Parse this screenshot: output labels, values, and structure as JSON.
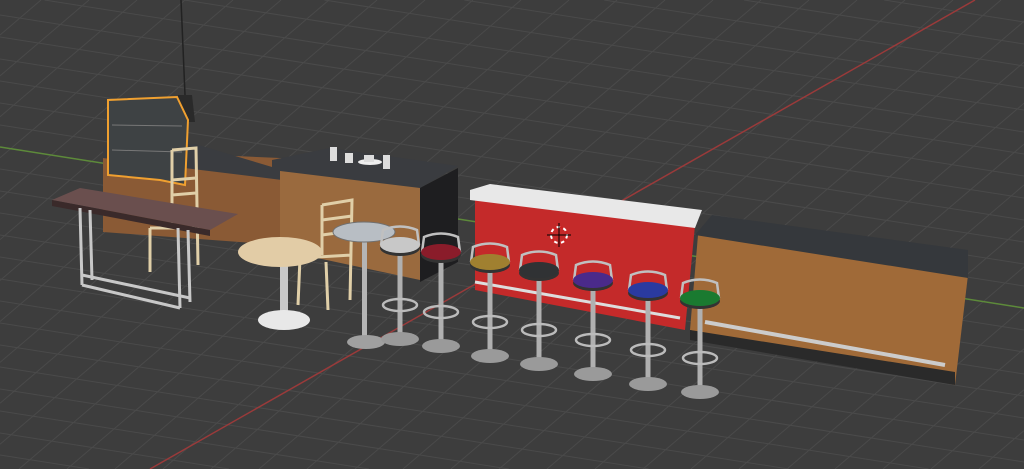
{
  "viewport": {
    "background": "#3d3d3d",
    "grid_color": "#4a4a4a",
    "x_axis_color": "#9a3a3a",
    "y_axis_color": "#5d8a3a",
    "selection_color": "#f0a030"
  },
  "stools": [
    {
      "seat": "#c8c8c8"
    },
    {
      "seat": "#8a1c2a"
    },
    {
      "seat": "#a08030"
    },
    {
      "seat": "#303234"
    },
    {
      "seat": "#4a2a8a"
    },
    {
      "seat": "#2a3aa0"
    },
    {
      "seat": "#1a7a30"
    }
  ],
  "icons": [
    "3d-cursor-icon"
  ]
}
